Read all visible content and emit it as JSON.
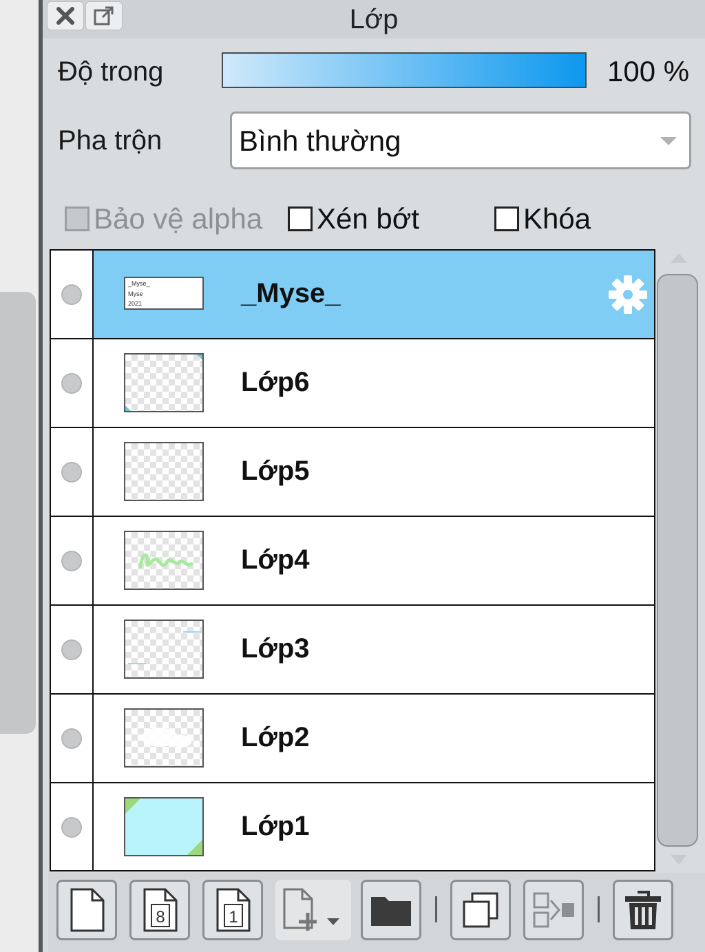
{
  "panel": {
    "title": "Lớp",
    "close_icon": "close-icon",
    "popout_icon": "popout-icon"
  },
  "opacity": {
    "label": "Độ trong",
    "value_text": "100 %",
    "level": 1.0,
    "gradient_colors": [
      "#cfe9fb",
      "#0d98ee"
    ]
  },
  "blend": {
    "label": "Pha trộn",
    "selected": "Bình thường"
  },
  "options": {
    "protect_alpha": {
      "label": "Bảo vệ alpha",
      "checked": false,
      "enabled": false
    },
    "clipping": {
      "label": "Xén bớt",
      "checked": false,
      "enabled": true
    },
    "lock": {
      "label": "Khóa",
      "checked": false,
      "enabled": true
    }
  },
  "layers": [
    {
      "name": "_Myse_",
      "selected": true
    },
    {
      "name": "Lớp6",
      "selected": false
    },
    {
      "name": "Lớp5",
      "selected": false
    },
    {
      "name": "Lớp4",
      "selected": false
    },
    {
      "name": "Lớp3",
      "selected": false
    },
    {
      "name": "Lớp2",
      "selected": false
    },
    {
      "name": "Lớp1",
      "selected": false
    }
  ],
  "layer_thumb_text": [
    "_Myse_",
    "Myse",
    "2021"
  ],
  "toolbar": {
    "icons": [
      "new-layer-icon",
      "new-8bit-layer-icon",
      "new-1bit-layer-icon",
      "add-layer-menu-icon",
      "new-folder-icon",
      "duplicate-layer-icon",
      "merge-down-icon",
      "delete-layer-icon"
    ],
    "badge_8": "8",
    "badge_1": "1"
  },
  "colors": {
    "selection": "#7fcdf5",
    "accent": "#0d98ee"
  }
}
